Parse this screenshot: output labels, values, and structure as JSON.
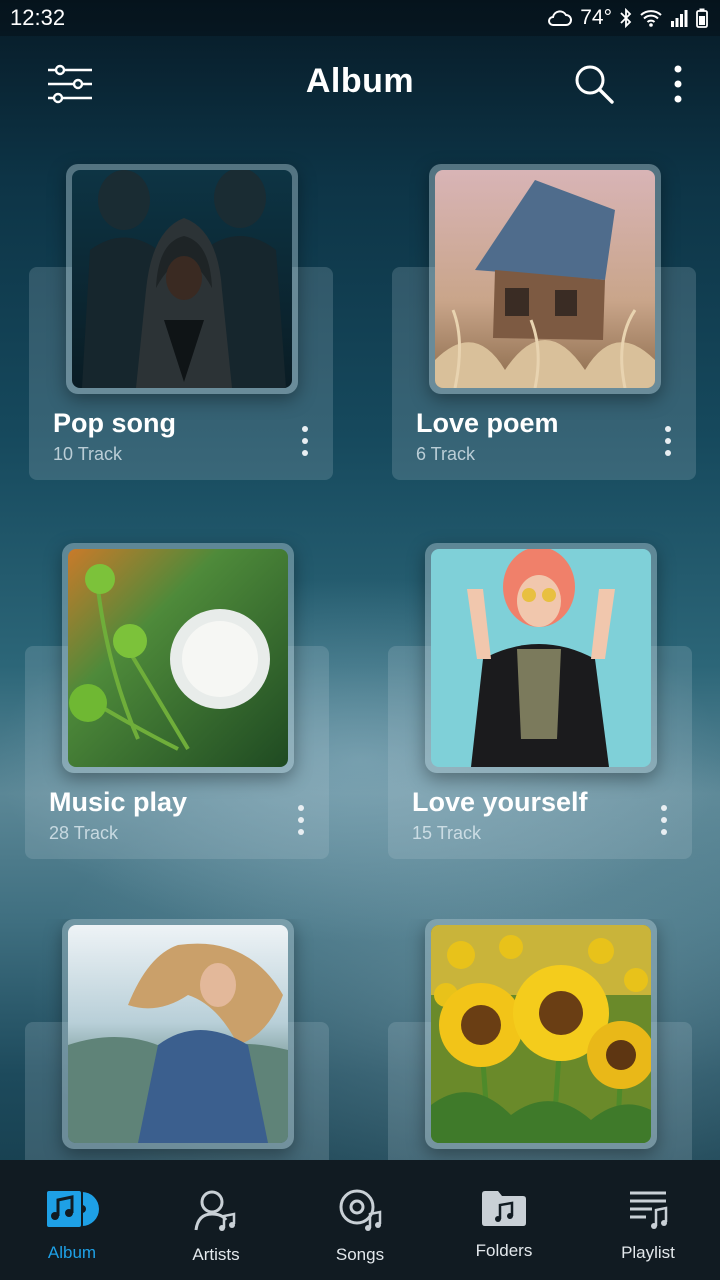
{
  "status_bar": {
    "time": "12:32",
    "temperature": "74°",
    "icons": [
      "cloud-icon",
      "bluetooth-icon",
      "wifi-icon",
      "signal-icon",
      "battery-icon"
    ]
  },
  "header": {
    "title": "Album",
    "icons": [
      "filter-sliders-icon",
      "search-icon",
      "more-vertical-icon"
    ]
  },
  "albums": [
    {
      "name": "Pop song",
      "count": "10 Track",
      "cover": "group-portrait-art"
    },
    {
      "name": "Love poem",
      "count": "6 Track",
      "cover": "fairy-house-art"
    },
    {
      "name": "Music play",
      "count": "28 Track",
      "cover": "white-flower-art"
    },
    {
      "name": "Love yourself",
      "count": "15 Track",
      "cover": "pink-hair-woman-art"
    },
    {
      "name": "",
      "count": "",
      "cover": "windblown-hair-woman-art"
    },
    {
      "name": "",
      "count": "",
      "cover": "sunflowers-art"
    }
  ],
  "nav": [
    {
      "label": "Album",
      "icon": "album-icon",
      "active": true
    },
    {
      "label": "Artists",
      "icon": "artist-icon",
      "active": false
    },
    {
      "label": "Songs",
      "icon": "songs-disc-icon",
      "active": false
    },
    {
      "label": "Folders",
      "icon": "folder-music-icon",
      "active": false
    },
    {
      "label": "Playlist",
      "icon": "playlist-icon",
      "active": false
    }
  ],
  "colors": {
    "accent": "#1ea0e6",
    "nav_background": "#111b22",
    "text": "#ffffff"
  }
}
